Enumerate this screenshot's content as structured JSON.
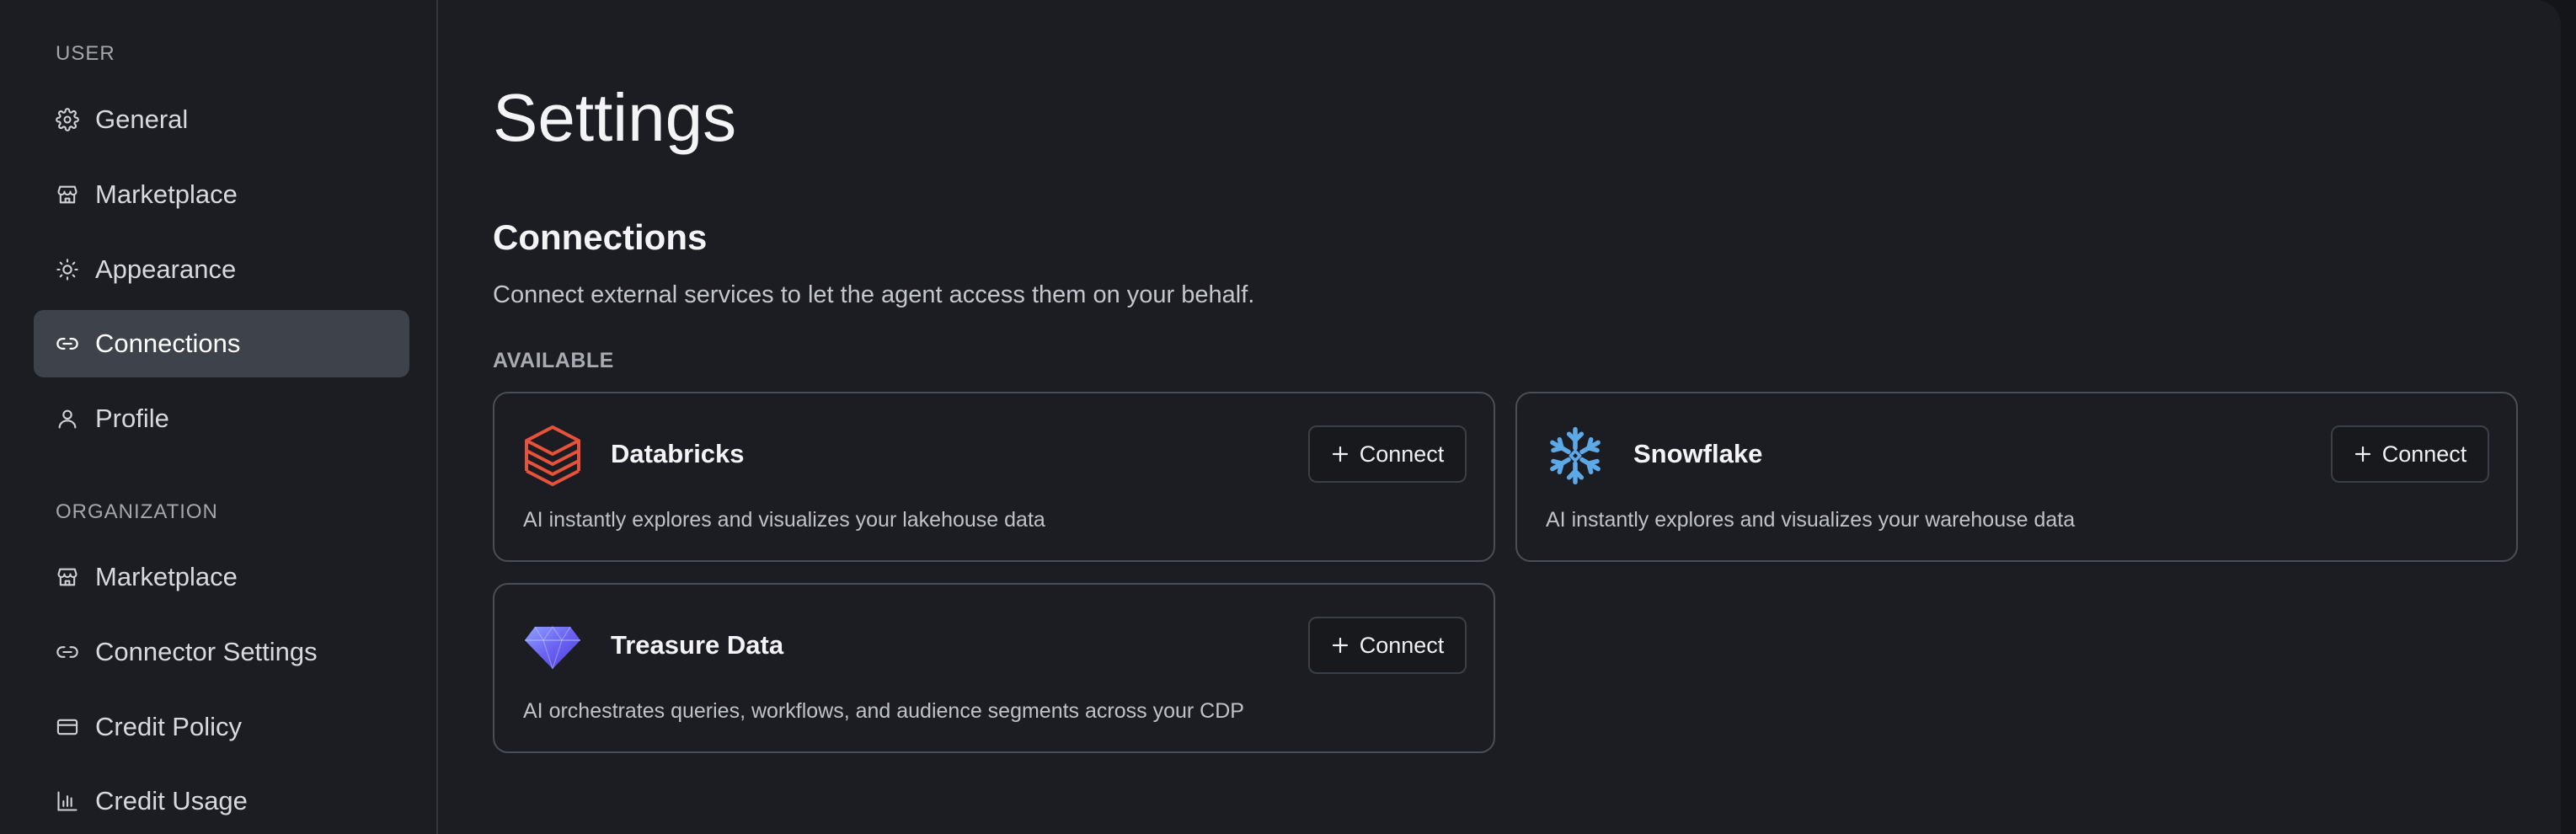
{
  "sidebar": {
    "user_label": "USER",
    "user_items": [
      {
        "label": "General",
        "icon": "gear-icon"
      },
      {
        "label": "Marketplace",
        "icon": "store-icon"
      },
      {
        "label": "Appearance",
        "icon": "sun-icon"
      },
      {
        "label": "Connections",
        "icon": "link-icon",
        "active": true
      },
      {
        "label": "Profile",
        "icon": "user-icon"
      }
    ],
    "org_label": "ORGANIZATION",
    "org_items": [
      {
        "label": "Marketplace",
        "icon": "store-icon"
      },
      {
        "label": "Connector Settings",
        "icon": "link-icon"
      },
      {
        "label": "Credit Policy",
        "icon": "credit-card-icon"
      },
      {
        "label": "Credit Usage",
        "icon": "bar-chart-icon"
      }
    ]
  },
  "main": {
    "title": "Settings",
    "section_title": "Connections",
    "section_desc": "Connect external services to let the agent access them on your behalf.",
    "available_label": "AVAILABLE",
    "cards": [
      {
        "name": "Databricks",
        "desc": "AI instantly explores and visualizes your lakehouse data",
        "button": "Connect",
        "logo": "databricks-logo"
      },
      {
        "name": "Snowflake",
        "desc": "AI instantly explores and visualizes your warehouse data",
        "button": "Connect",
        "logo": "snowflake-logo"
      },
      {
        "name": "Treasure Data",
        "desc": "AI orchestrates queries, workflows, and audience segments across your CDP",
        "button": "Connect",
        "logo": "treasure-data-logo"
      }
    ]
  },
  "colors": {
    "background": "#1b1d22",
    "active_item": "#3e434b",
    "databricks": "#e8513a",
    "snowflake": "#5da8e6",
    "treasure_data": "#6f6cf5"
  }
}
